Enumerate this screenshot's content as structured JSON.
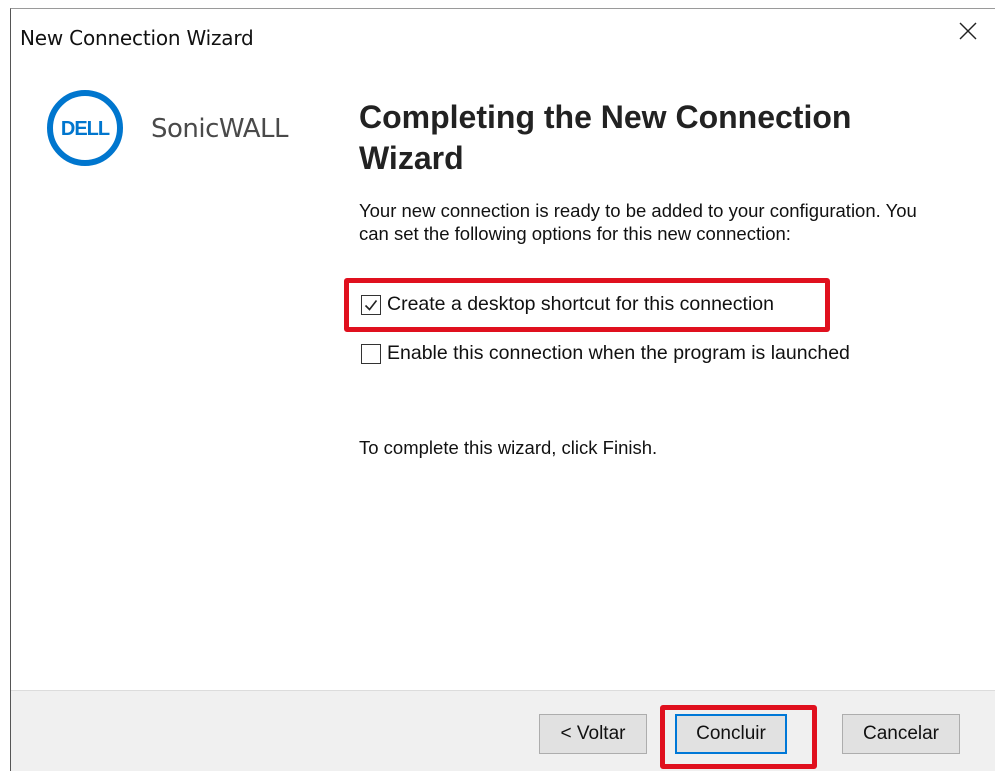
{
  "window": {
    "title": "New Connection Wizard",
    "close_symbol": "✕"
  },
  "branding": {
    "logo_icon": "dell-logo-icon",
    "logo_text": "DELL",
    "product_name": "SonicWALL",
    "brand_color": "#0076ce"
  },
  "content": {
    "heading": "Completing the New Connection Wizard",
    "description": "Your new connection is ready to be added to your configuration. You can set the following options for this new connection:",
    "options": [
      {
        "label": "Create a desktop shortcut for this connection",
        "checked": true
      },
      {
        "label": "Enable this connection when the program is launched",
        "checked": false
      }
    ],
    "finish_instruction": "To complete this wizard, click Finish."
  },
  "buttons": {
    "back_label": "< Voltar",
    "finish_label": "Concluir",
    "cancel_label": "Cancelar"
  },
  "colors": {
    "highlight": "#e0101e",
    "default_button_border": "#0078d7",
    "footer_bg": "#f0f0f0"
  }
}
